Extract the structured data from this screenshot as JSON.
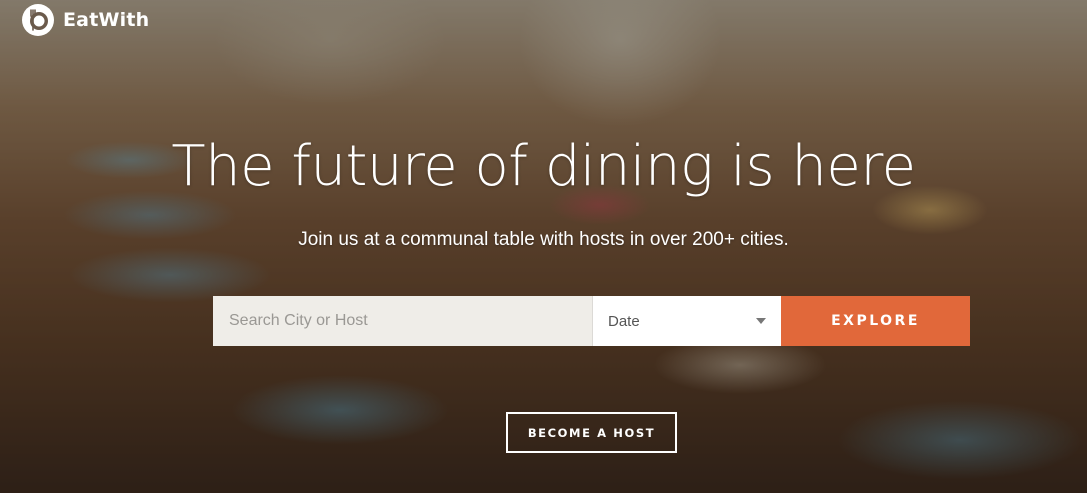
{
  "brand": {
    "name": "EatWith",
    "logo_icon": "fork-plate-icon"
  },
  "hero": {
    "headline": "The future of dining is here",
    "subheadline": "Join us at a communal table with hosts in over 200+ cities."
  },
  "search": {
    "input_value": "",
    "placeholder": "Search City or Host",
    "date_selected": "Date",
    "explore_label": "EXPLORE"
  },
  "cta": {
    "become_host_label": "BECOME A HOST"
  },
  "colors": {
    "accent": "#e1683a",
    "input_background": "#efede8",
    "text_light": "#ffffff"
  }
}
